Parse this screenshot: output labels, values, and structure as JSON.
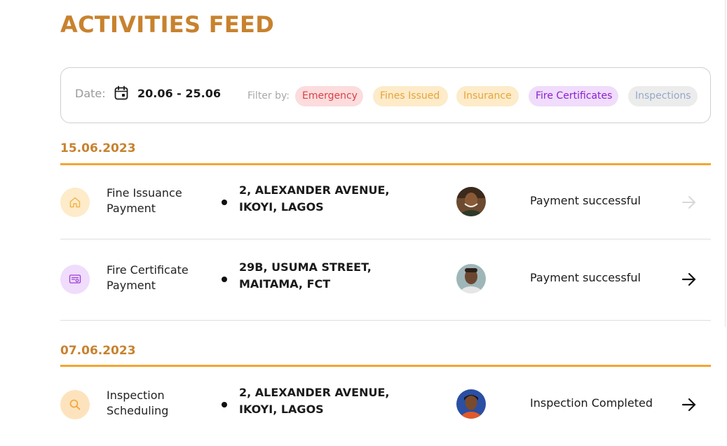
{
  "page": {
    "title": "ACTIVITIES FEED"
  },
  "filters": {
    "date_label": "Date:",
    "date_range": "20.06 - 25.06",
    "filter_label": "Filter by:",
    "chips": [
      {
        "label": "Emergency",
        "color": "#d9414a"
      },
      {
        "label": "Fines Issued",
        "color": "#e5a53c"
      },
      {
        "label": "Insurance",
        "color": "#e5a53c"
      },
      {
        "label": "Fire Certificates",
        "color": "#8a1fd0"
      },
      {
        "label": "Inspections",
        "color": "#96a9c6"
      }
    ]
  },
  "sections": [
    {
      "date": "15.06.2023",
      "rows": [
        {
          "icon": "home-icon",
          "title_line1": "Fine Issuance",
          "title_line2": "Payment",
          "address_line1": "2, ALEXANDER AVENUE,",
          "address_line2": "IKOYI, LAGOS",
          "status": "Payment successful",
          "arrow": "disabled"
        },
        {
          "icon": "certificate-icon",
          "title_line1": "Fire Certificate",
          "title_line2": "Payment",
          "address_line1": "29B, USUMA STREET,",
          "address_line2": "MAITAMA, FCT",
          "status": "Payment successful",
          "arrow": "active"
        }
      ]
    },
    {
      "date": "07.06.2023",
      "rows": [
        {
          "icon": "search-icon",
          "title_line1": "Inspection",
          "title_line2": "Scheduling",
          "address_line1": "2, ALEXANDER AVENUE,",
          "address_line2": "IKOYI, LAGOS",
          "status": "Inspection Completed",
          "arrow": "active"
        }
      ]
    }
  ],
  "colors": {
    "accent": "#c8822e",
    "section_rule": "#f4a52e"
  }
}
